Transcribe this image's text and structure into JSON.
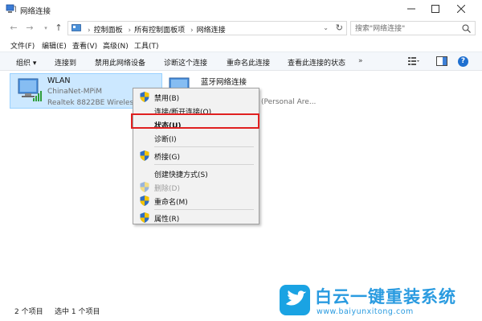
{
  "window": {
    "title": "网络连接"
  },
  "address": {
    "crumbs": [
      "控制面板",
      "所有控制面板项",
      "网络连接"
    ],
    "search_placeholder": "搜索\"网络连接\""
  },
  "menu": [
    "文件(F)",
    "编辑(E)",
    "查看(V)",
    "高级(N)",
    "工具(T)"
  ],
  "commands": [
    "组织",
    "连接到",
    "禁用此网络设备",
    "诊断这个连接",
    "重命名此连接",
    "查看此连接的状态",
    "»"
  ],
  "connections": [
    {
      "name": "WLAN",
      "network": "ChinaNet-MPiM",
      "adapter": "Realtek 8822BE Wireless"
    },
    {
      "name": "蓝牙网络连接",
      "network": "",
      "adapter": "(Personal Are..."
    }
  ],
  "context_menu": [
    {
      "label": "禁用(B)",
      "shield": true,
      "bold": false,
      "disabled": false
    },
    {
      "label": "连接/断开连接(O)",
      "shield": false,
      "bold": false,
      "disabled": false
    },
    {
      "label": "状态(U)",
      "shield": false,
      "bold": true,
      "disabled": false
    },
    {
      "label": "诊断(I)",
      "shield": false,
      "bold": false,
      "disabled": false
    },
    {
      "label": "桥接(G)",
      "shield": true,
      "bold": false,
      "disabled": false
    },
    {
      "label": "创建快捷方式(S)",
      "shield": false,
      "bold": false,
      "disabled": false
    },
    {
      "label": "删除(D)",
      "shield": true,
      "bold": false,
      "disabled": true
    },
    {
      "label": "重命名(M)",
      "shield": true,
      "bold": false,
      "disabled": false
    },
    {
      "label": "属性(R)",
      "shield": true,
      "bold": false,
      "disabled": false
    }
  ],
  "status": {
    "count": "2 个项目",
    "selected": "选中 1 个项目"
  },
  "watermark": {
    "title": "白云一键重装系统",
    "url": "www.baiyunxitong.com"
  },
  "colors": {
    "selection": "#cce8ff",
    "highlight_box": "#e02020",
    "help": "#1e6fd0",
    "watermark": "#2a9be0"
  }
}
